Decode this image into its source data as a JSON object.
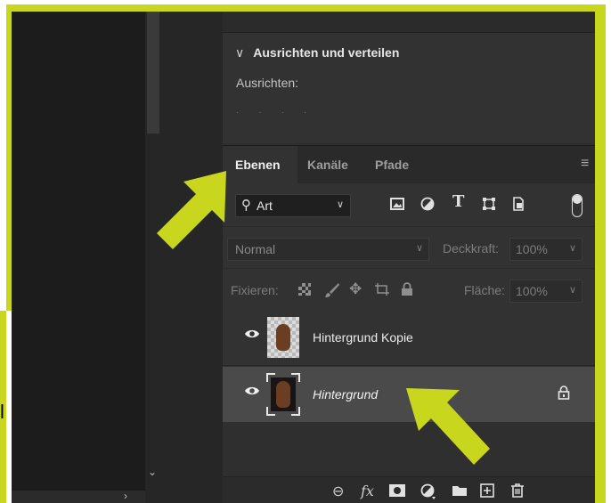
{
  "panels": {
    "align": {
      "title": "Ausrichten und verteilen",
      "subtitle": "Ausrichten:"
    },
    "tabs": [
      {
        "label": "Ebenen",
        "active": true
      },
      {
        "label": "Kanäle",
        "active": false
      },
      {
        "label": "Pfade",
        "active": false
      }
    ],
    "filter": {
      "kind_label": "Art",
      "icons": [
        "image-filter-icon",
        "adjustment-filter-icon",
        "type-filter-icon",
        "shape-filter-icon",
        "smart-object-filter-icon"
      ]
    },
    "blend": {
      "mode": "Normal",
      "opacity_label": "Deckkraft:",
      "opacity_value": "100%"
    },
    "lock": {
      "label": "Fixieren:",
      "fill_label": "Fläche:",
      "fill_value": "100%"
    },
    "layers": [
      {
        "name": "Hintergrund Kopie",
        "italic": false,
        "locked": false,
        "selected": false
      },
      {
        "name": "Hintergrund",
        "italic": true,
        "locked": true,
        "selected": true
      }
    ],
    "bottom_icons": [
      "link-layers-icon",
      "fx-icon",
      "mask-icon",
      "adjustment-layer-icon",
      "group-icon",
      "new-layer-icon",
      "delete-icon"
    ]
  },
  "accent_color": "#c8d61e",
  "cut_off_text": "l"
}
